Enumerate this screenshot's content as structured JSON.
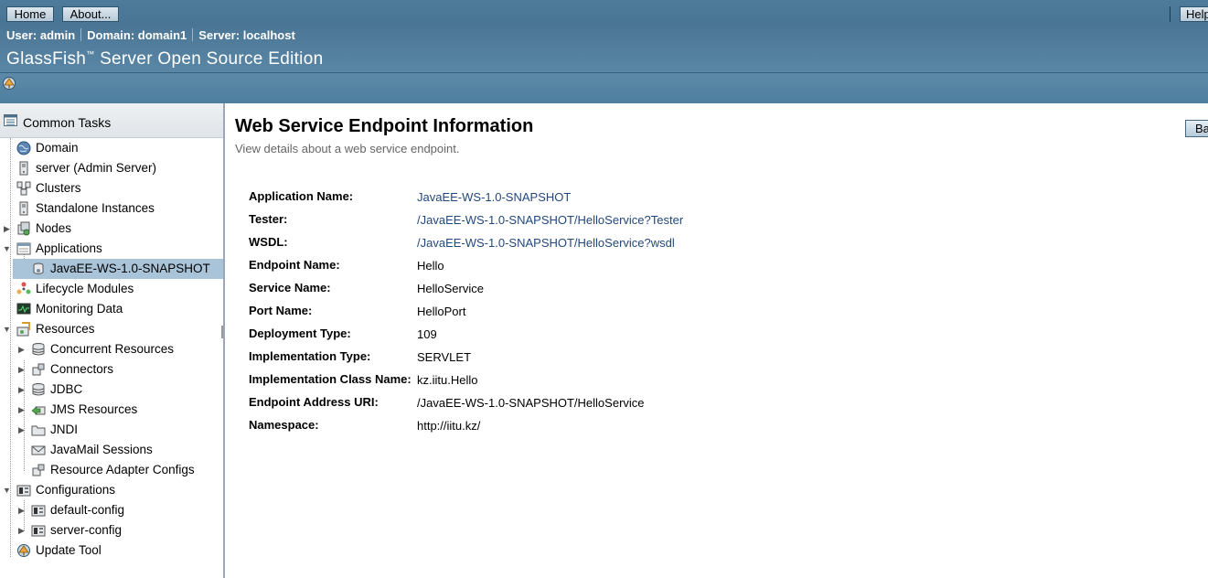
{
  "masthead": {
    "home_label": "Home",
    "about_label": "About...",
    "help_label": "Help",
    "user_label": "User:",
    "user_value": "admin",
    "domain_label": "Domain:",
    "domain_value": "domain1",
    "server_label": "Server:",
    "server_value": "localhost",
    "product_name": "GlassFish",
    "product_tm": "™",
    "product_rest": " Server Open Source Edition",
    "update_icon": "update-available-icon"
  },
  "sidebar": {
    "header": "Common Tasks",
    "items": [
      {
        "label": "Domain",
        "icon": "globe-icon"
      },
      {
        "label": "server (Admin Server)",
        "icon": "server-icon"
      },
      {
        "label": "Clusters",
        "icon": "cluster-icon"
      },
      {
        "label": "Standalone Instances",
        "icon": "server-icon"
      },
      {
        "label": "Nodes",
        "icon": "node-icon"
      },
      {
        "label": "Applications",
        "icon": "applications-icon"
      },
      {
        "label": "JavaEE-WS-1.0-SNAPSHOT",
        "icon": "web-service-icon"
      },
      {
        "label": "Lifecycle Modules",
        "icon": "lifecycle-icon"
      },
      {
        "label": "Monitoring Data",
        "icon": "monitor-icon"
      },
      {
        "label": "Resources",
        "icon": "resources-icon"
      },
      {
        "label": "Concurrent Resources",
        "icon": "database-icon"
      },
      {
        "label": "Connectors",
        "icon": "connector-icon"
      },
      {
        "label": "JDBC",
        "icon": "database-icon"
      },
      {
        "label": "JMS Resources",
        "icon": "jms-icon"
      },
      {
        "label": "JNDI",
        "icon": "folder-icon"
      },
      {
        "label": "JavaMail Sessions",
        "icon": "mail-icon"
      },
      {
        "label": "Resource Adapter Configs",
        "icon": "connector-icon"
      },
      {
        "label": "Configurations",
        "icon": "configuration-icon"
      },
      {
        "label": "default-config",
        "icon": "configuration-icon"
      },
      {
        "label": "server-config",
        "icon": "configuration-icon"
      },
      {
        "label": "Update Tool",
        "icon": "update-tool-icon"
      }
    ]
  },
  "content": {
    "title": "Web Service Endpoint Information",
    "help_text": "View details about a web service endpoint.",
    "back_label": "Back",
    "fields": [
      {
        "label": "Application Name:",
        "value": "JavaEE-WS-1.0-SNAPSHOT",
        "link": true
      },
      {
        "label": "Tester:",
        "value": "/JavaEE-WS-1.0-SNAPSHOT/HelloService?Tester",
        "link": true
      },
      {
        "label": "WSDL:",
        "value": "/JavaEE-WS-1.0-SNAPSHOT/HelloService?wsdl",
        "link": true
      },
      {
        "label": "Endpoint Name:",
        "value": "Hello",
        "link": false
      },
      {
        "label": "Service Name:",
        "value": "HelloService",
        "link": false
      },
      {
        "label": "Port Name:",
        "value": "HelloPort",
        "link": false
      },
      {
        "label": "Deployment Type:",
        "value": "109",
        "link": false
      },
      {
        "label": "Implementation Type:",
        "value": "SERVLET",
        "link": false
      },
      {
        "label": "Implementation Class Name:",
        "value": "kz.iitu.Hello",
        "link": false
      },
      {
        "label": "Endpoint Address URI:",
        "value": "/JavaEE-WS-1.0-SNAPSHOT/HelloService",
        "link": false
      },
      {
        "label": "Namespace:",
        "value": "http://iitu.kz/",
        "link": false
      }
    ]
  }
}
